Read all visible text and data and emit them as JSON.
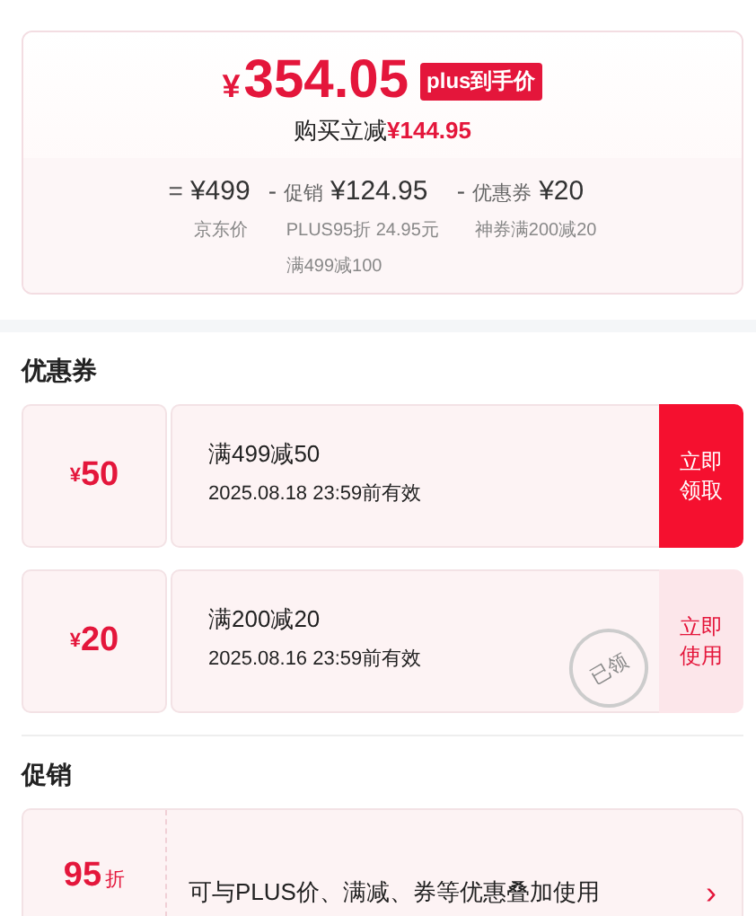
{
  "price_card": {
    "currency": "¥",
    "price": "354.05",
    "badge": "plus到手价",
    "saving_label": "购买立减",
    "saving": "¥144.95",
    "breakdown": [
      {
        "operator": "=",
        "amount": "¥499",
        "notes": [
          "京东价"
        ]
      },
      {
        "operator": "-",
        "label": "促销",
        "amount": "¥124.95",
        "notes": [
          "PLUS95折 24.95元",
          "满499减100"
        ]
      },
      {
        "operator": "-",
        "label": "优惠券",
        "amount": "¥20",
        "notes": [
          "神券满200减20"
        ]
      }
    ]
  },
  "coupons": {
    "title": "优惠券",
    "items": [
      {
        "currency": "¥",
        "value": "50",
        "condition": "满499减50",
        "validity": "2025.08.18 23:59前有效",
        "action": "立即领取",
        "claimed": false
      },
      {
        "currency": "¥",
        "value": "20",
        "condition": "满200减20",
        "validity": "2025.08.16 23:59前有效",
        "action": "立即使用",
        "claimed": true,
        "stamp": "已领"
      }
    ]
  },
  "promotions": {
    "title": "促销",
    "items": [
      {
        "value": "95",
        "unit": "折",
        "description": "可与PLUS价、满减、券等优惠叠加使用",
        "arrow": "›"
      }
    ]
  }
}
